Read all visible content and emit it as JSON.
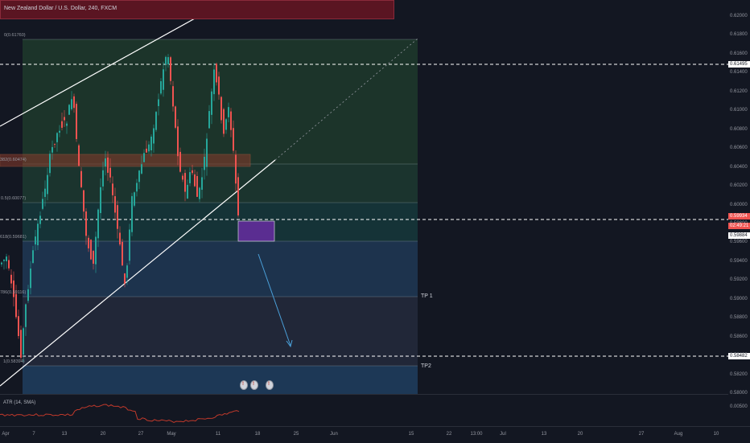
{
  "title": "New Zealand Dollar / U.S. Dollar, 240, FXCM",
  "price_axis": [
    "0.62000",
    "0.61800",
    "0.61600",
    "0.61400",
    "0.61200",
    "0.61000",
    "0.60800",
    "0.60600",
    "0.60400",
    "0.60200",
    "0.60000",
    "0.59800",
    "0.59600",
    "0.59400",
    "0.59200",
    "0.59000",
    "0.58800",
    "0.58600",
    "0.58400",
    "0.58200",
    "0.58000"
  ],
  "price_tags": {
    "upper": "0.61495",
    "current": "0.59934",
    "countdown": "02:49:21",
    "entry": "0.59884",
    "lower": "0.58482"
  },
  "fib_labels": {
    "zero": "0(0.61760)",
    "level382": "382(0.60474)",
    "level5": "0.5(0.60077)",
    "level618": "618(0.59681)",
    "level786": "786(0.59116)",
    "one": "1(0.58394)"
  },
  "targets": {
    "tp1": "TP 1",
    "tp2": "TP2"
  },
  "indicator": {
    "label": "ATR (14, SMA)",
    "value": "0.00500"
  },
  "time_axis": [
    "Apr",
    "7",
    "13",
    "20",
    "27",
    "May",
    "11",
    "18",
    "25",
    "Jun",
    "15",
    "22",
    "13:00",
    "Jul",
    "13",
    "20",
    "27",
    "Aug",
    "10"
  ],
  "colors": {
    "bg": "#131722",
    "bull": "#26a69a",
    "bear": "#ef5350",
    "fib_green": "#1e3b2e",
    "fib_teal": "#17343a",
    "fib_blue": "#1d3a5a",
    "box_purple": "#5a2d91",
    "title_red": "#5a1522"
  }
}
